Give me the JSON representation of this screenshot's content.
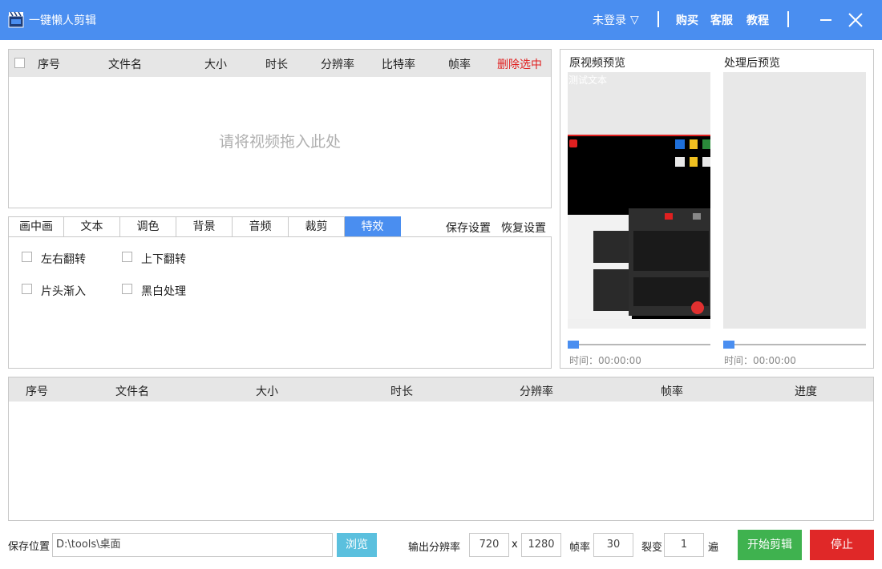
{
  "window": {
    "title": "一键懒人剪辑",
    "login": "未登录",
    "login_arrow": "▽",
    "links": [
      "购买",
      "客服",
      "教程"
    ]
  },
  "file_list": {
    "columns": [
      "序号",
      "文件名",
      "大小",
      "时长",
      "分辨率",
      "比特率",
      "帧率"
    ],
    "delete_selected": "删除选中",
    "drop_hint": "请将视频拖入此处"
  },
  "tabs": {
    "items": [
      "画中画",
      "文本",
      "调色",
      "背景",
      "音频",
      "裁剪",
      "特效"
    ],
    "active": "特效",
    "save_settings": "保存设置",
    "restore_settings": "恢复设置"
  },
  "effects": {
    "flip_horizontal": "左右翻转",
    "flip_vertical": "上下翻转",
    "fade_in": "片头渐入",
    "black_white": "黑白处理"
  },
  "preview": {
    "original_title": "原视频预览",
    "processed_title": "处理后预览",
    "overlay_text": "测试文本",
    "original_time": "时间：00:00:00",
    "processed_time": "时间：00:00:00"
  },
  "output_list": {
    "columns": [
      "序号",
      "文件名",
      "大小",
      "时长",
      "分辨率",
      "帧率",
      "进度"
    ]
  },
  "bottom": {
    "save_location_label": "保存位置",
    "save_path": "D:\\tools\\桌面",
    "browse": "浏览",
    "output_res_label": "输出分辨率",
    "width": "720",
    "x": "x",
    "height": "1280",
    "fps_label": "帧率",
    "fps": "30",
    "split_label": "裂变",
    "split": "1",
    "times": "遍",
    "start": "开始剪辑",
    "stop": "停止"
  },
  "colors": {
    "accent": "#4a8ef0",
    "delete_red": "#e02020",
    "start_green": "#3fb24f",
    "stop_red": "#e02828",
    "browse_cyan": "#5bc0de"
  }
}
